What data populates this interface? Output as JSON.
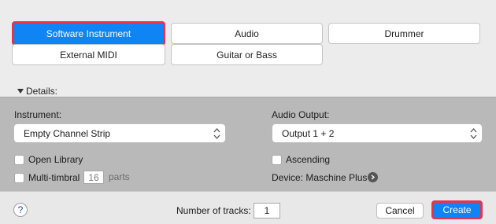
{
  "track_types": {
    "software_instrument": "Software Instrument",
    "audio": "Audio",
    "drummer": "Drummer",
    "external_midi": "External MIDI",
    "guitar_or_bass": "Guitar or Bass"
  },
  "details_label": "Details:",
  "instrument": {
    "label": "Instrument:",
    "value": "Empty Channel Strip"
  },
  "audio_output": {
    "label": "Audio Output:",
    "value": "Output 1 + 2"
  },
  "options": {
    "open_library": "Open Library",
    "multi_timbral": "Multi-timbral",
    "parts_value": "16",
    "parts_label": "parts",
    "ascending": "Ascending",
    "device": "Device: Maschine Plus"
  },
  "footer": {
    "help": "?",
    "tracks_label": "Number of tracks:",
    "tracks_value": "1",
    "cancel": "Cancel",
    "create": "Create"
  },
  "colors": {
    "accent": "#0f84f4",
    "highlight": "#e8334f"
  }
}
